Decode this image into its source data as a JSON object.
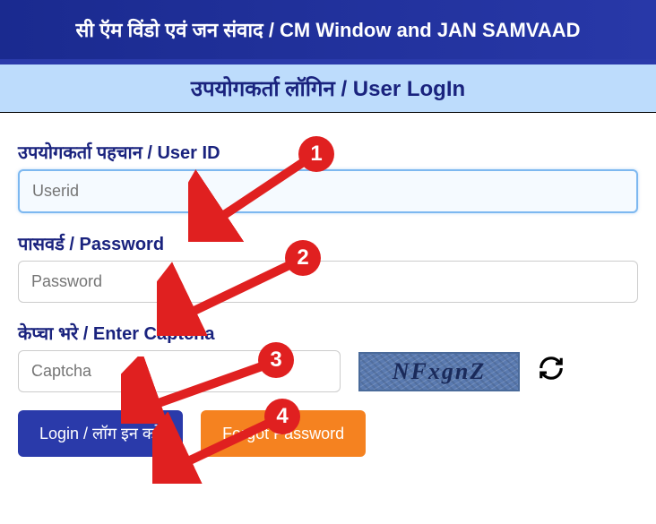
{
  "header": {
    "title": "सी ऍम विंडो एवं जन संवाद / CM Window and JAN SAMVAAD"
  },
  "subheader": {
    "title": "उपयोगकर्ता लॉगिन / User LogIn"
  },
  "form": {
    "userid_label": "उपयोगकर्ता पहचान / User ID",
    "userid_placeholder": "Userid",
    "password_label": "पासवर्ड / Password",
    "password_placeholder": "Password",
    "captcha_label": "केप्चा भरे / Enter Captcha",
    "captcha_placeholder": "Captcha",
    "captcha_text": "NFxgnZ"
  },
  "buttons": {
    "login": "Login / लॉग इन करें",
    "forgot": "Forgot Password"
  },
  "markers": {
    "m1": "1",
    "m2": "2",
    "m3": "3",
    "m4": "4"
  }
}
